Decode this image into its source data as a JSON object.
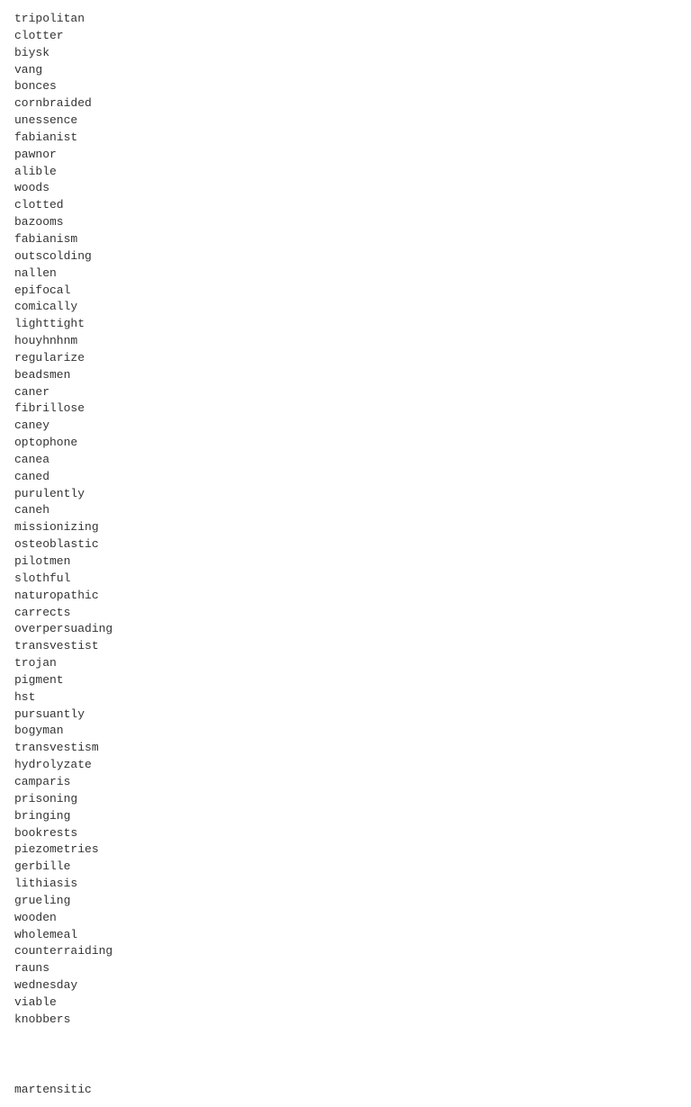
{
  "words": [
    "tripolitan",
    "clotter",
    "biysk",
    "vang",
    "bonces",
    "cornbraided",
    "unessence",
    "fabianist",
    "pawnor",
    "alible",
    "woods",
    "clotted",
    "bazooms",
    "fabianism",
    "outscolding",
    "nallen",
    "epifocal",
    "comically",
    "lighttight",
    "houyhnhnm",
    "regularize",
    "beadsmen",
    "caner",
    "fibrillose",
    "caney",
    "optophone",
    "canea",
    "caned",
    "purulently",
    "caneh",
    "missionizing",
    "osteoblastic",
    "pilotmen",
    "slothful",
    "naturopathic",
    "carrects",
    "overpersuading",
    "transvestist",
    "trojan",
    "pigment",
    "hst",
    "pursuantly",
    "bogyman",
    "transvestism",
    "hydrolyzate",
    "camparis",
    "prisoning",
    "bringing",
    "bookrests",
    "piezometries",
    "gerbille",
    "lithiasis",
    "grueling",
    "wooden",
    "wholemeal",
    "counterraiding",
    "rauns",
    "wednesday",
    "viable",
    "knobbers"
  ],
  "bottom_words": [
    "martensitic"
  ]
}
